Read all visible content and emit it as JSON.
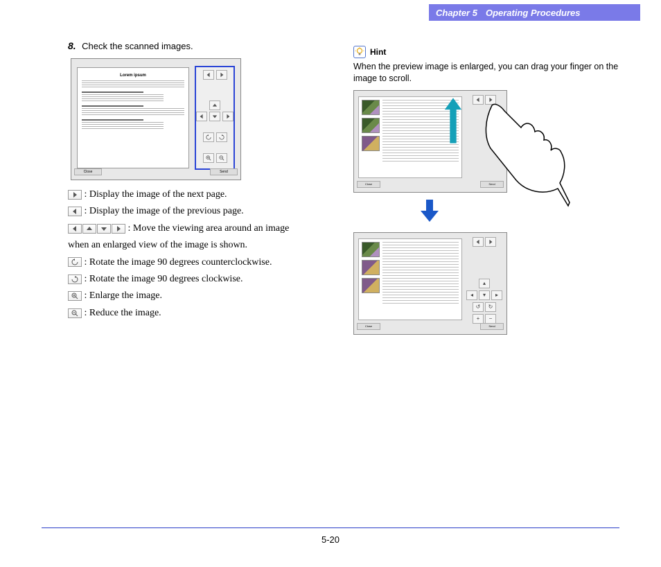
{
  "header": {
    "chapter": "Chapter 5",
    "title": "Operating Procedures"
  },
  "step": {
    "number": "8.",
    "text": "Check the scanned images."
  },
  "scanner": {
    "doc_title": "Lorem ipsum",
    "close": "Close",
    "send": "Send"
  },
  "legend": {
    "next": ": Display the image of the next page.",
    "prev": ": Display the image of the previous page.",
    "move": ": Move the viewing area around an image",
    "move2": "when an enlarged view of the image is shown.",
    "rot_ccw": ": Rotate the image 90 degrees counterclockwise.",
    "rot_cw": ": Rotate the image 90 degrees clockwise.",
    "enlarge": ": Enlarge the image.",
    "reduce": ": Reduce the image."
  },
  "hint": {
    "label": "Hint",
    "text": "When the preview image is enlarged, you can drag your finger on the image to scroll."
  },
  "preview": {
    "close": "Close",
    "send": "Send"
  },
  "footer": {
    "page": "5-20"
  }
}
